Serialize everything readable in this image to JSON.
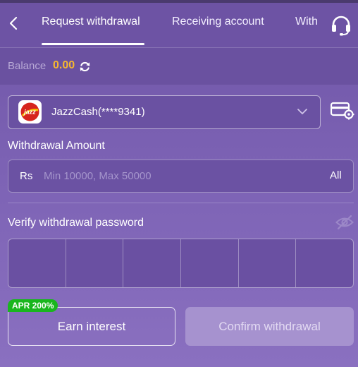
{
  "header": {
    "tabs": [
      {
        "label": "Request withdrawal",
        "active": true
      },
      {
        "label": "Receiving account",
        "active": false
      },
      {
        "label": "With",
        "active": false
      }
    ]
  },
  "balance": {
    "label": "Balance",
    "value": "0.00"
  },
  "account": {
    "logo_text": "jazz",
    "name": "JazzCash(****9341)"
  },
  "withdrawal_amount": {
    "label": "Withdrawal Amount",
    "currency": "Rs",
    "placeholder": "Min 10000, Max 50000",
    "all_label": "All"
  },
  "password": {
    "label": "Verify withdrawal password",
    "digits": 6
  },
  "actions": {
    "apr_badge": "APR 200%",
    "earn_label": "Earn interest",
    "confirm_label": "Confirm withdrawal"
  },
  "colors": {
    "accent": "#f5b72f",
    "badge": "#19b61e",
    "background": "#7c62b4"
  }
}
